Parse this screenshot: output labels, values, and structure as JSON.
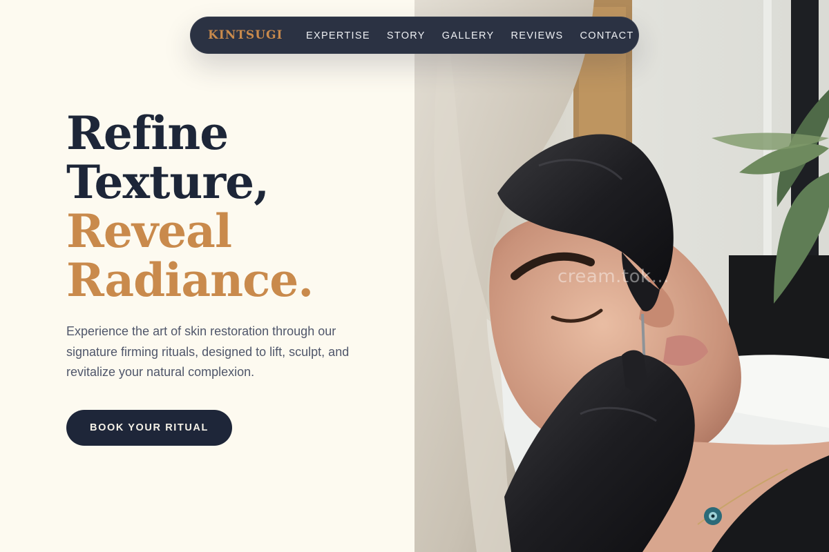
{
  "nav": {
    "logo": "KINTSUGI",
    "links": [
      "EXPERTISE",
      "STORY",
      "GALLERY",
      "REVIEWS",
      "CONTACT"
    ]
  },
  "hero": {
    "headline_line1": "Refine",
    "headline_line2": "Texture,",
    "headline_line3": "Reveal",
    "headline_line4": "Radiance.",
    "description": "Experience the art of skin restoration through our signature firming rituals, designed to lift, sculpt, and revitalize your natural complexion.",
    "cta_label": "BOOK YOUR RITUAL"
  },
  "photo": {
    "watermark": "cream.tok..."
  },
  "colors": {
    "background": "#fdfaf0",
    "navy": "#1e2639",
    "accent": "#c98a4c",
    "body_text": "#4f566a"
  }
}
